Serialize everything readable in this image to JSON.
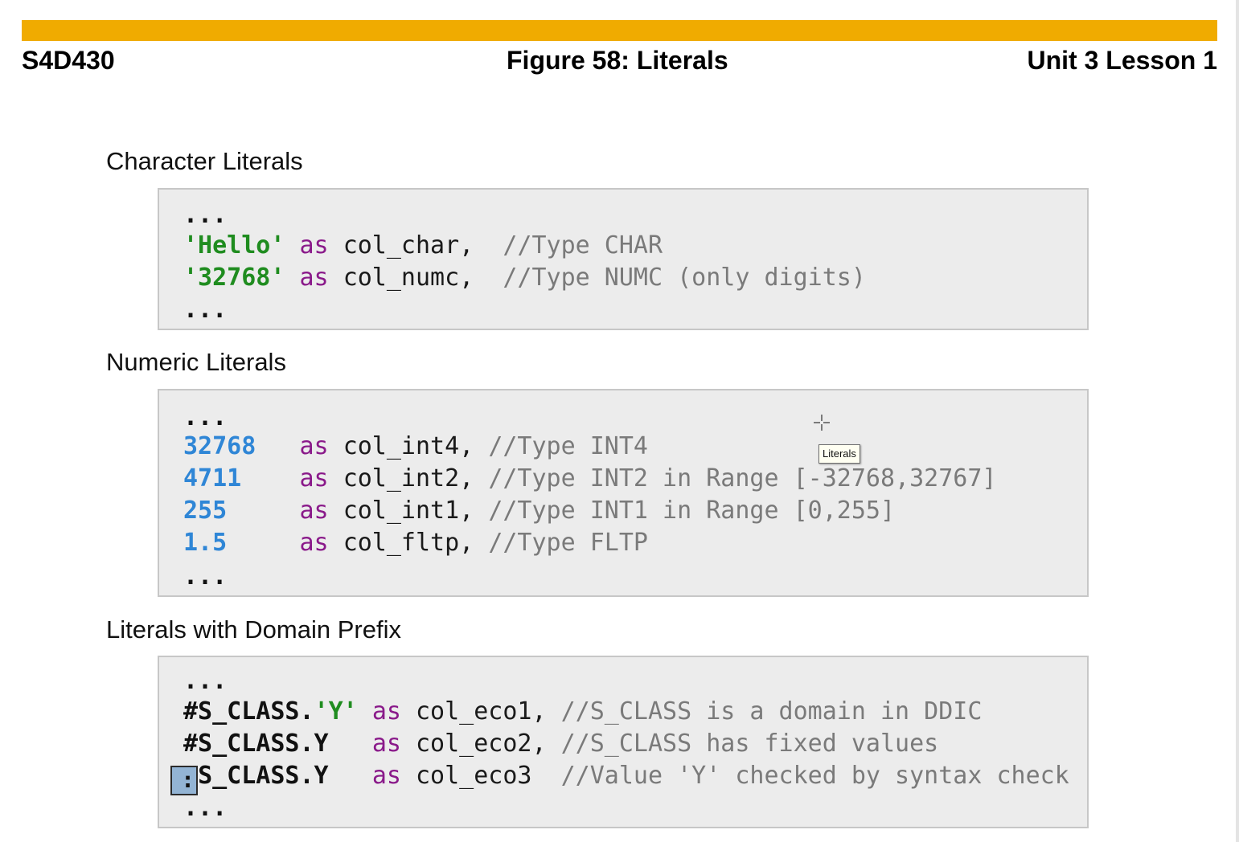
{
  "header": {
    "course": "S4D430",
    "figure_title": "Figure 58: Literals",
    "unit": "Unit 3 Lesson 1"
  },
  "colors": {
    "accent_bar": "#f0ab00",
    "string_literal": "#1f8c1f",
    "numeric_literal": "#2f86d6",
    "keyword": "#8a1a8a",
    "comment": "#7a7a7a",
    "code_background": "#ececec"
  },
  "sections": {
    "character": {
      "title": "Character Literals",
      "dots": "...",
      "lines": [
        {
          "literal": "'Hello'",
          "kw": "as",
          "name": "col_char,",
          "comment": "//Type CHAR"
        },
        {
          "literal": "'32768'",
          "kw": "as",
          "name": "col_numc,",
          "comment": "//Type NUMC (only digits)"
        }
      ]
    },
    "numeric": {
      "title": "Numeric Literals",
      "dots": "...",
      "lines": [
        {
          "literal": "32768",
          "kw": "as",
          "name": "col_int4,",
          "comment": "//Type INT4"
        },
        {
          "literal": "4711",
          "kw": "as",
          "name": "col_int2,",
          "comment": "//Type INT2 in Range [-32768,32767]"
        },
        {
          "literal": "255",
          "kw": "as",
          "name": "col_int1,",
          "comment": "//Type INT1 in Range [0,255]"
        },
        {
          "literal": "1.5",
          "kw": "as",
          "name": "col_fltp,",
          "comment": "//Type FLTP"
        }
      ]
    },
    "domain": {
      "title": "Literals with Domain Prefix",
      "dots": "...",
      "lines": [
        {
          "domain": "#S_CLASS.",
          "literal": "'Y'",
          "kw": "as",
          "name": "col_eco1,",
          "comment": "//S_CLASS is a domain in DDIC"
        },
        {
          "domain": "#S_CLASS.Y",
          "literal": "",
          "kw": "as",
          "name": "col_eco2,",
          "comment": "//S_CLASS has fixed values"
        },
        {
          "domain": "S_CLASS.Y",
          "literal": "",
          "kw": "as",
          "name": "col_eco3",
          "comment": "//Value 'Y' checked by syntax check"
        }
      ],
      "caret_char": ":"
    }
  },
  "tooltip": {
    "text": "Literals"
  },
  "icons": {
    "cursor": "crosshair-cursor-icon"
  }
}
